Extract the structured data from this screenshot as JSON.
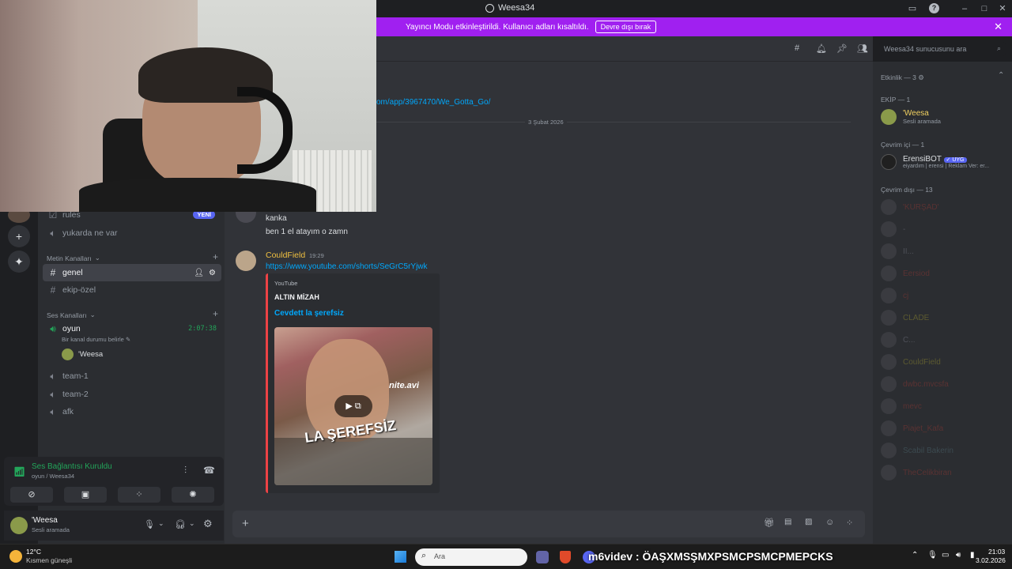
{
  "window": {
    "title": "Weesa34"
  },
  "banner": {
    "text": "Yayıncı Modu etkinleştirildi. Kullanıcı adları kısaltıldı.",
    "button": "Devre dışı bırak"
  },
  "header": {
    "search_placeholder": "Weesa34 sunucusunu ara"
  },
  "sidebar": {
    "channels_top": [
      {
        "label": "rules",
        "badge": "YENİ"
      },
      {
        "label": "yukarda ne var"
      }
    ],
    "text_category": "Metin Kanalları",
    "text_channels": [
      {
        "label": "genel"
      },
      {
        "label": "ekip-özel"
      }
    ],
    "voice_category": "Ses Kanalları",
    "voice_channels": [
      {
        "label": "oyun",
        "timer": "2:07:38",
        "status": "Bir kanal durumu belirle",
        "user": "'Weesa"
      },
      {
        "label": "team-1"
      },
      {
        "label": "team-2"
      },
      {
        "label": "afk"
      }
    ]
  },
  "voice_panel": {
    "title": "Ses Bağlantısı Kuruldu",
    "subtitle": "oyun / Weesa34"
  },
  "user_panel": {
    "name": "'Weesa",
    "status": "Sesli aramada"
  },
  "chat": {
    "link_partial": "om/app/3967470/We_Gotta_Go/",
    "date_divider": "3 Şubat 2026",
    "messages": [
      {
        "text": "kanka"
      },
      {
        "text": "ben 1 el atayım o zamn"
      }
    ],
    "post": {
      "author": "CouldField",
      "time": "19:29",
      "link": "https://www.youtube.com/shorts/SeGrC5rYjwk",
      "embed": {
        "provider": "YouTube",
        "channel": "ALTIN MİZAH",
        "title": "Cevdett la şerefsiz",
        "thumb_caption": "LA ŞEREFSİZ",
        "thumb_watermark": "nite.avi"
      }
    }
  },
  "members": {
    "activity_header": "Etkinlik — 3",
    "groups": [
      {
        "header": "EKİP — 1",
        "items": [
          {
            "name": "'Weesa",
            "status": "Sesli aramada",
            "color": "#f0d060"
          }
        ]
      },
      {
        "header": "Çevrim içi — 1",
        "items": [
          {
            "name": "ErensiBOT",
            "tag": "UYG",
            "status": "eiyardım | erensi | Reklam Ver: er...",
            "color": "#dbdee1"
          }
        ]
      },
      {
        "header": "Çevrim dışı — 13",
        "items": [
          {
            "name": "'KURŞAD'",
            "color": "#5a3232"
          },
          {
            "name": "-",
            "color": "#4e5058"
          },
          {
            "name": "II...",
            "color": "#4e5058"
          },
          {
            "name": "Eersiod",
            "color": "#5a3232"
          },
          {
            "name": "cj",
            "color": "#5a3232"
          },
          {
            "name": "CLADE",
            "color": "#5c5a30"
          },
          {
            "name": "C...",
            "color": "#4e5058"
          },
          {
            "name": "CouldField",
            "color": "#5c5a30"
          },
          {
            "name": "dwbc.mvcsfa",
            "color": "#5a3232"
          },
          {
            "name": "mevc",
            "color": "#5a3232"
          },
          {
            "name": "Piajet_Kafa",
            "color": "#5a3232"
          },
          {
            "name": "Scabil Bakerin",
            "color": "#3c4a50"
          },
          {
            "name": "TheCelikbiran",
            "color": "#5a3232"
          }
        ]
      }
    ]
  },
  "taskbar": {
    "weather_temp": "12°C",
    "weather_text": "Kısmen güneşli",
    "search_placeholder": "Ara",
    "overlay_text": "m6videv : ÖAŞXMSŞMXPSMCPSMCPMEPCKS",
    "time": "21:03",
    "date": "3.02.2026"
  }
}
